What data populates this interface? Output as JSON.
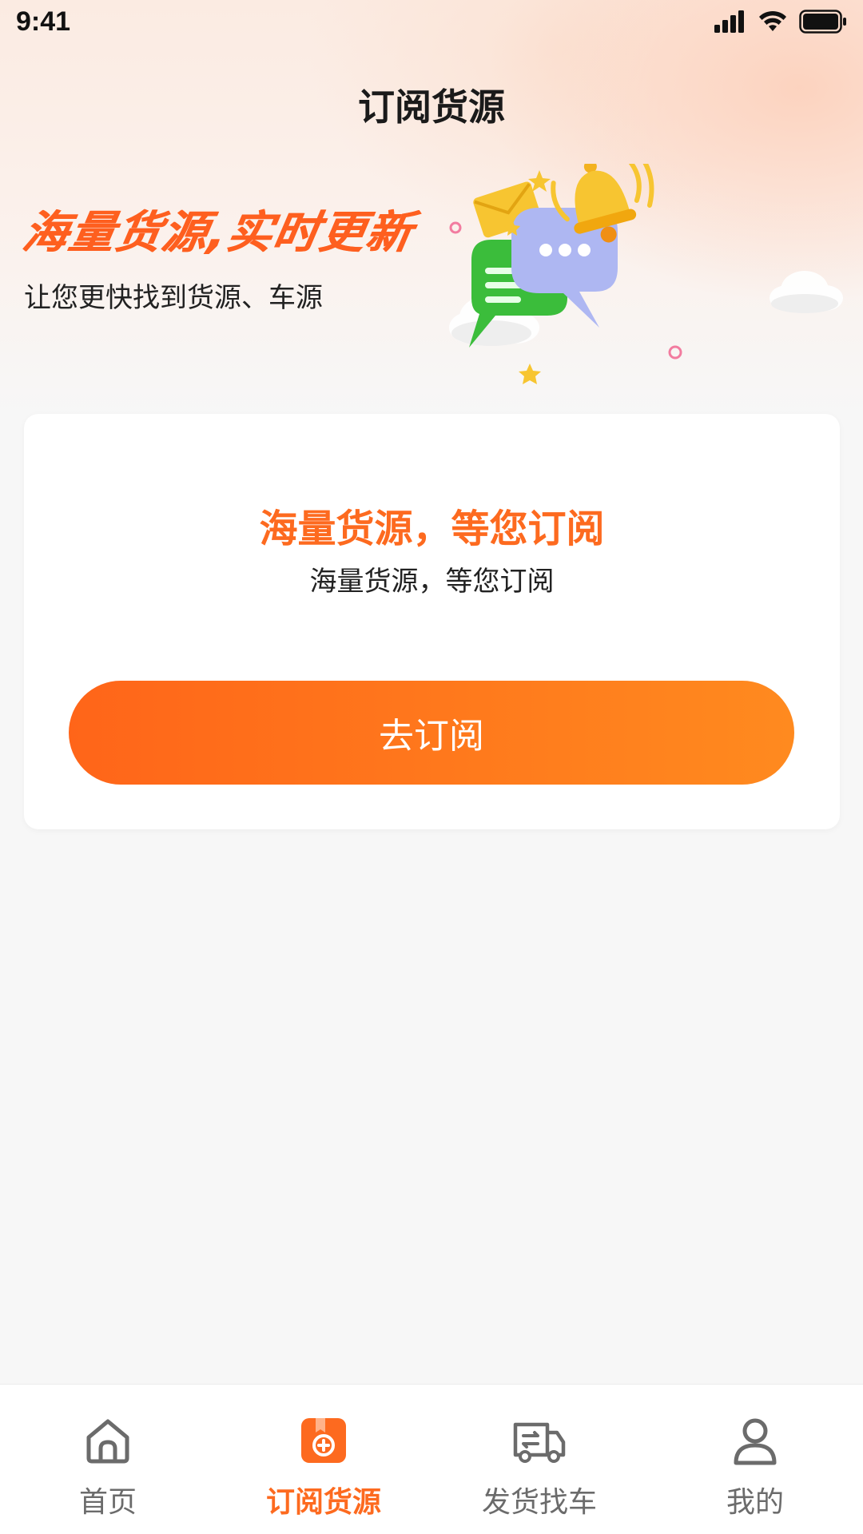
{
  "status_bar": {
    "time": "9:41"
  },
  "nav": {
    "title": "订阅货源"
  },
  "banner": {
    "slogan": "海量货源,实时更新",
    "subtitle": "让您更快找到货源、车源"
  },
  "card": {
    "title": "海量货源，等您订阅",
    "subtitle": "海量货源，等您订阅",
    "button_label": "去订阅"
  },
  "tabbar": {
    "items": [
      {
        "label": "首页",
        "icon": "home-icon",
        "active": false
      },
      {
        "label": "订阅货源",
        "icon": "subscribe-icon",
        "active": true
      },
      {
        "label": "发货找车",
        "icon": "truck-icon",
        "active": false
      },
      {
        "label": "我的",
        "icon": "user-icon",
        "active": false
      }
    ]
  },
  "colors": {
    "accent": "#fd6a1f",
    "button_start": "#ff6519",
    "button_end": "#ff8a1f",
    "page_bg": "#f7f7f7"
  }
}
